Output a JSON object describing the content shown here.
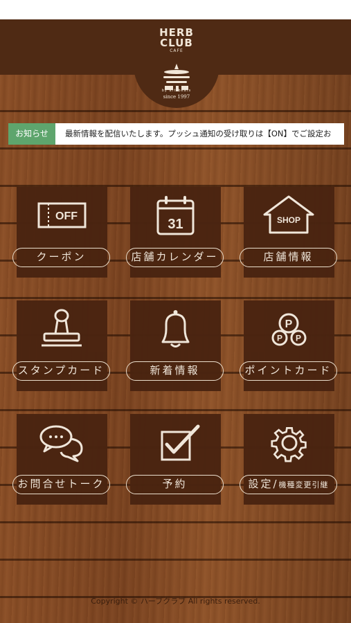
{
  "logo": {
    "line1": "HERB",
    "line2": "CLUB",
    "line3": "CAFE",
    "tagline": "by art-beats",
    "since": "since 1997"
  },
  "news": {
    "tag": "お知らせ",
    "text": "最新情報を配信いたします。プッシュ通知の受け取りは【ON】でご設定お"
  },
  "menu": [
    {
      "label": "クーポン",
      "icon": "off-coupon-icon",
      "icon_text": "OFF"
    },
    {
      "label": "店舗カレンダー",
      "icon": "calendar-icon",
      "icon_text": "31"
    },
    {
      "label": "店舗情報",
      "icon": "shop-icon",
      "icon_text": "SHOP"
    },
    {
      "label": "スタンプカード",
      "icon": "stamp-icon"
    },
    {
      "label": "新着情報",
      "icon": "bell-icon"
    },
    {
      "label": "ポイントカード",
      "icon": "points-icon",
      "icon_text": "P"
    },
    {
      "label": "お問合せトーク",
      "icon": "chat-bubbles-icon"
    },
    {
      "label": "予約",
      "icon": "checkbox-icon"
    },
    {
      "label_main": "設定/",
      "label_small": "機種変更引継",
      "icon": "gear-icon"
    }
  ],
  "footer": "Copyright © ハーブクラブ All rights reserved.",
  "colors": {
    "header": "#4f2a14",
    "tile": "#4a2411",
    "news_tag": "#5ea56d",
    "pill_border": "#efe4d3"
  }
}
